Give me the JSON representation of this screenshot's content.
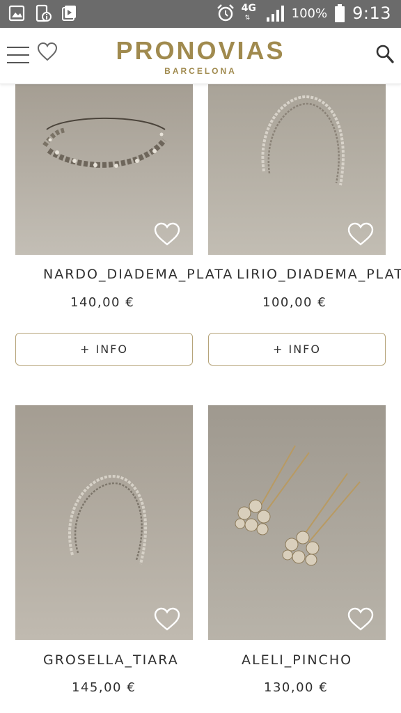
{
  "status_bar": {
    "battery": "100%",
    "time": "9:13",
    "network": "4G"
  },
  "header": {
    "brand_name": "PRONOVIAS",
    "brand_sub": "BARCELONA",
    "brand_color": "#a08a4e"
  },
  "products": [
    {
      "name": "NARDO_DIADEMA_PLATA",
      "price": "140,00 €",
      "button": "+ INFO"
    },
    {
      "name": "LIRIO_DIADEMA_PLATA",
      "price": "100,00 €",
      "button": "+ INFO"
    },
    {
      "name": "GROSELLA_TIARA",
      "price": "145,00 €"
    },
    {
      "name": "ALELI_PINCHO",
      "price": "130,00 €"
    }
  ],
  "icons": [
    "menu-icon",
    "heart-icon",
    "search-icon",
    "gallery-icon",
    "info-phone-icon",
    "download-icon",
    "alarm-icon",
    "signal-icon",
    "battery-icon"
  ]
}
